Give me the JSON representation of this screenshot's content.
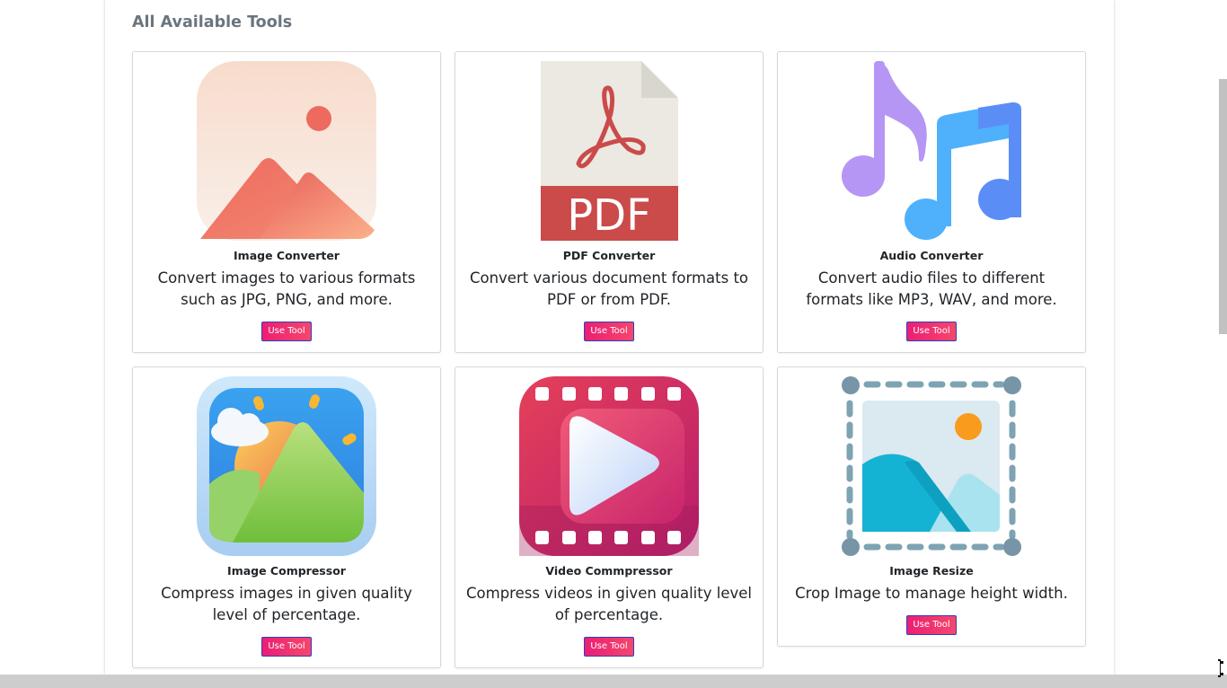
{
  "section": {
    "title": "All Available Tools"
  },
  "tools": [
    {
      "title": "Image Converter",
      "description": "Convert images to various formats such as JPG, PNG, and more.",
      "button": "Use Tool",
      "icon": "image-icon"
    },
    {
      "title": "PDF Converter",
      "description": "Convert various document formats to PDF or from PDF.",
      "button": "Use Tool",
      "icon": "pdf-icon",
      "icon_text": "PDF"
    },
    {
      "title": "Audio Converter",
      "description": "Convert audio files to different formats like MP3, WAV, and more.",
      "button": "Use Tool",
      "icon": "music-notes-icon"
    },
    {
      "title": "Image Compressor",
      "description": "Compress images in given quality level of percentage.",
      "button": "Use Tool",
      "icon": "landscape-photo-icon"
    },
    {
      "title": "Video Commpressor",
      "description": "Compress videos in given quality level of percentage.",
      "button": "Use Tool",
      "icon": "video-play-icon"
    },
    {
      "title": "Image Resize",
      "description": "Crop Image to manage height width.",
      "button": "Use Tool",
      "icon": "crop-resize-icon"
    }
  ],
  "colors": {
    "button_gradient_start": "#ec1e74",
    "button_gradient_end": "#f4476c",
    "button_border": "#2f3fbf",
    "title_gray": "#6c757d"
  }
}
